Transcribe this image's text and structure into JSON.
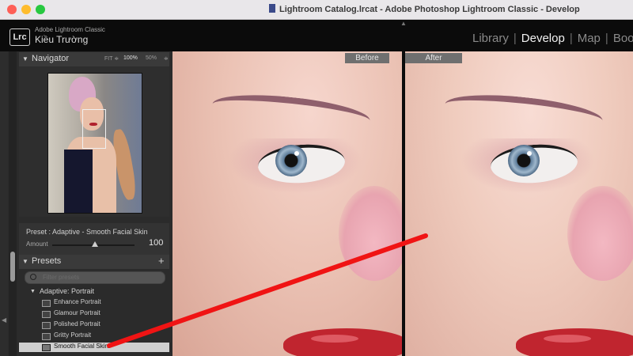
{
  "window": {
    "title": "Lightroom Catalog.lrcat - Adobe Photoshop Lightroom Classic - Develop"
  },
  "app": {
    "logo": "Lrc",
    "product": "Adobe Lightroom Classic",
    "user": "Kiều Trường"
  },
  "modules": {
    "library": "Library",
    "develop": "Develop",
    "map": "Map",
    "book": "Book"
  },
  "navigator": {
    "title": "Navigator",
    "zoom_fit": "FIT ≑",
    "zoom_100": "100%",
    "zoom_50": "50%",
    "zoom_more": "≑"
  },
  "preset_panel": {
    "preset_label": "Preset : Adaptive - Smooth Facial Skin",
    "amount_label": "Amount",
    "amount_value": "100",
    "amount_fraction": 1.0
  },
  "presets": {
    "title": "Presets",
    "add": "+",
    "search_placeholder": "Filter presets",
    "group": "Adaptive: Portrait",
    "items": [
      "Enhance Portrait",
      "Glamour Portrait",
      "Polished Portrait",
      "Gritty Portrait",
      "Smooth Facial Skin"
    ],
    "selected_index": 4
  },
  "compare": {
    "before": "Before",
    "after": "After"
  },
  "colors": {
    "annotation_arrow": "#f01414",
    "selected_row": "#cfcfcf",
    "lips": "#c0252f"
  },
  "icons": {
    "traffic_lights": [
      "close-button",
      "minimize-button",
      "zoom-button"
    ],
    "search": "search-icon",
    "preset_item": "preset-icon"
  }
}
